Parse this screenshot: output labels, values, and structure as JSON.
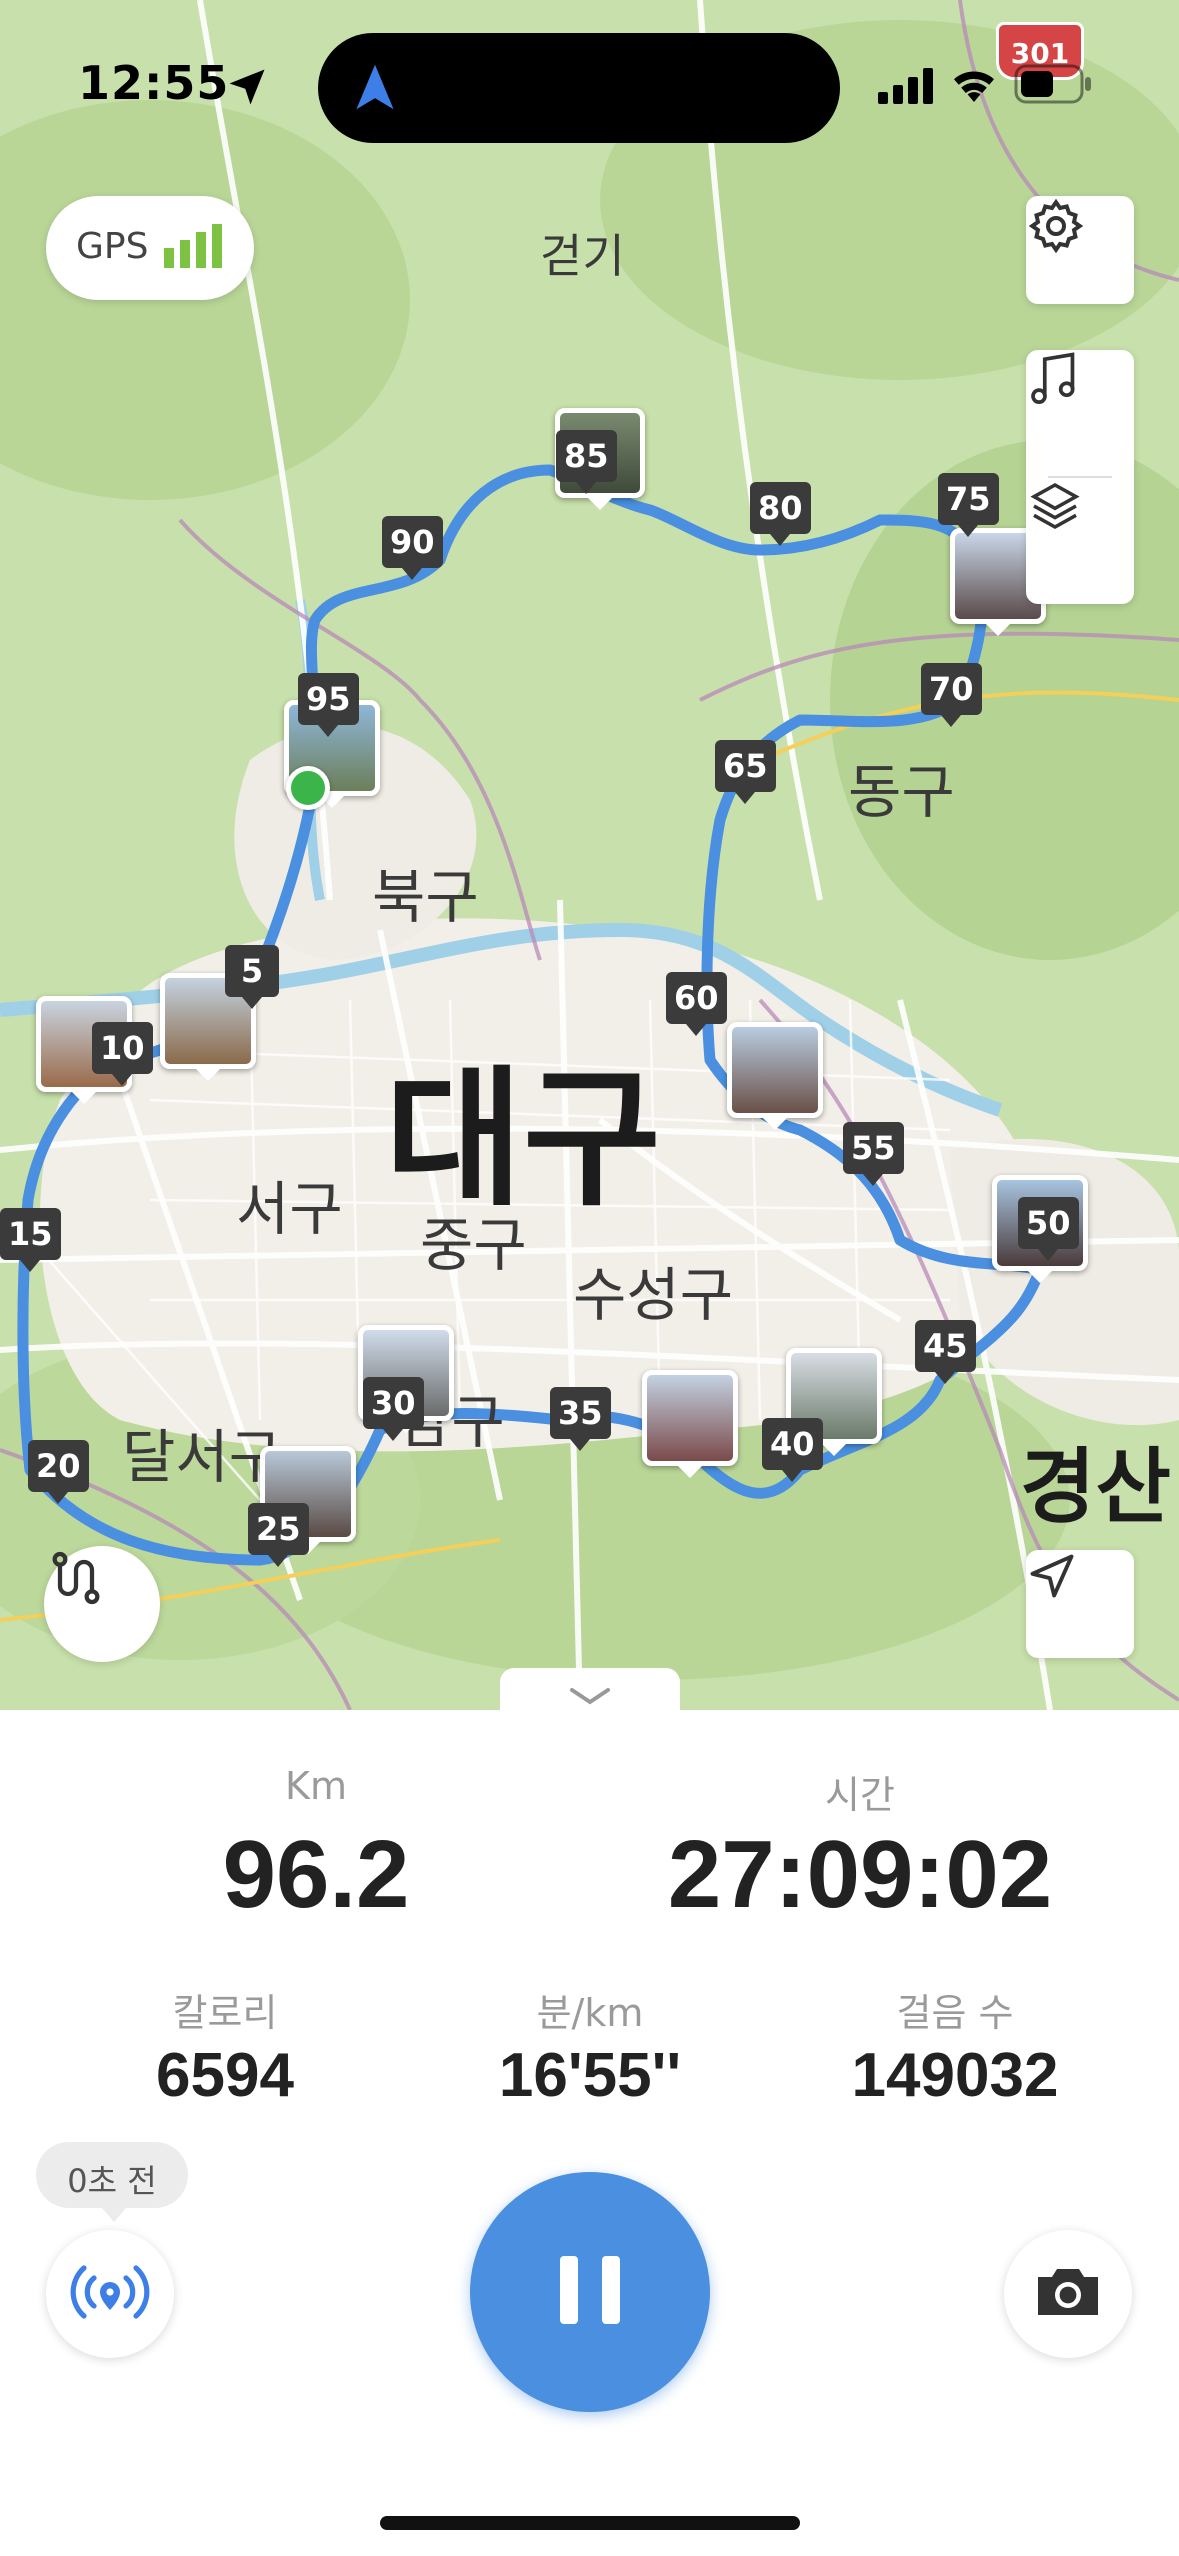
{
  "status_bar": {
    "time": "12:55",
    "highway_badge": "301"
  },
  "map": {
    "gps_label": "GPS",
    "mode_label": "걷기",
    "places": {
      "daegu": "대구",
      "buk_gu": "북구",
      "dong_gu": "동구",
      "seo_gu": "서구",
      "jung_gu": "중구",
      "suseong_gu": "수성구",
      "dalseo_gu": "달서구",
      "nam_gu": "남구",
      "gyeongsan": "경산"
    },
    "km_markers": [
      "5",
      "10",
      "15",
      "20",
      "25",
      "30",
      "35",
      "40",
      "45",
      "50",
      "55",
      "60",
      "65",
      "70",
      "75",
      "80",
      "85",
      "90",
      "95"
    ],
    "route_color": "#4a8fe0",
    "start_color": "#3bb54a"
  },
  "stats": {
    "distance_label": "Km",
    "distance_value": "96.2",
    "time_label": "시간",
    "time_value": "27:09:02",
    "calories_label": "칼로리",
    "calories_value": "6594",
    "pace_label": "분/km",
    "pace_value": "16'55''",
    "steps_label": "걸음 수",
    "steps_value": "149032"
  },
  "controls": {
    "live_tooltip": "0초 전",
    "pause_color": "#4a8fe0"
  },
  "icons": [
    "location-arrow-icon",
    "gps-signal-icon",
    "gear-icon",
    "music-note-icon",
    "layers-icon",
    "route-icon",
    "navigation-arrow-icon",
    "chevron-down-icon",
    "live-broadcast-icon",
    "pause-icon",
    "camera-icon",
    "cellular-icon",
    "wifi-icon",
    "battery-icon"
  ]
}
